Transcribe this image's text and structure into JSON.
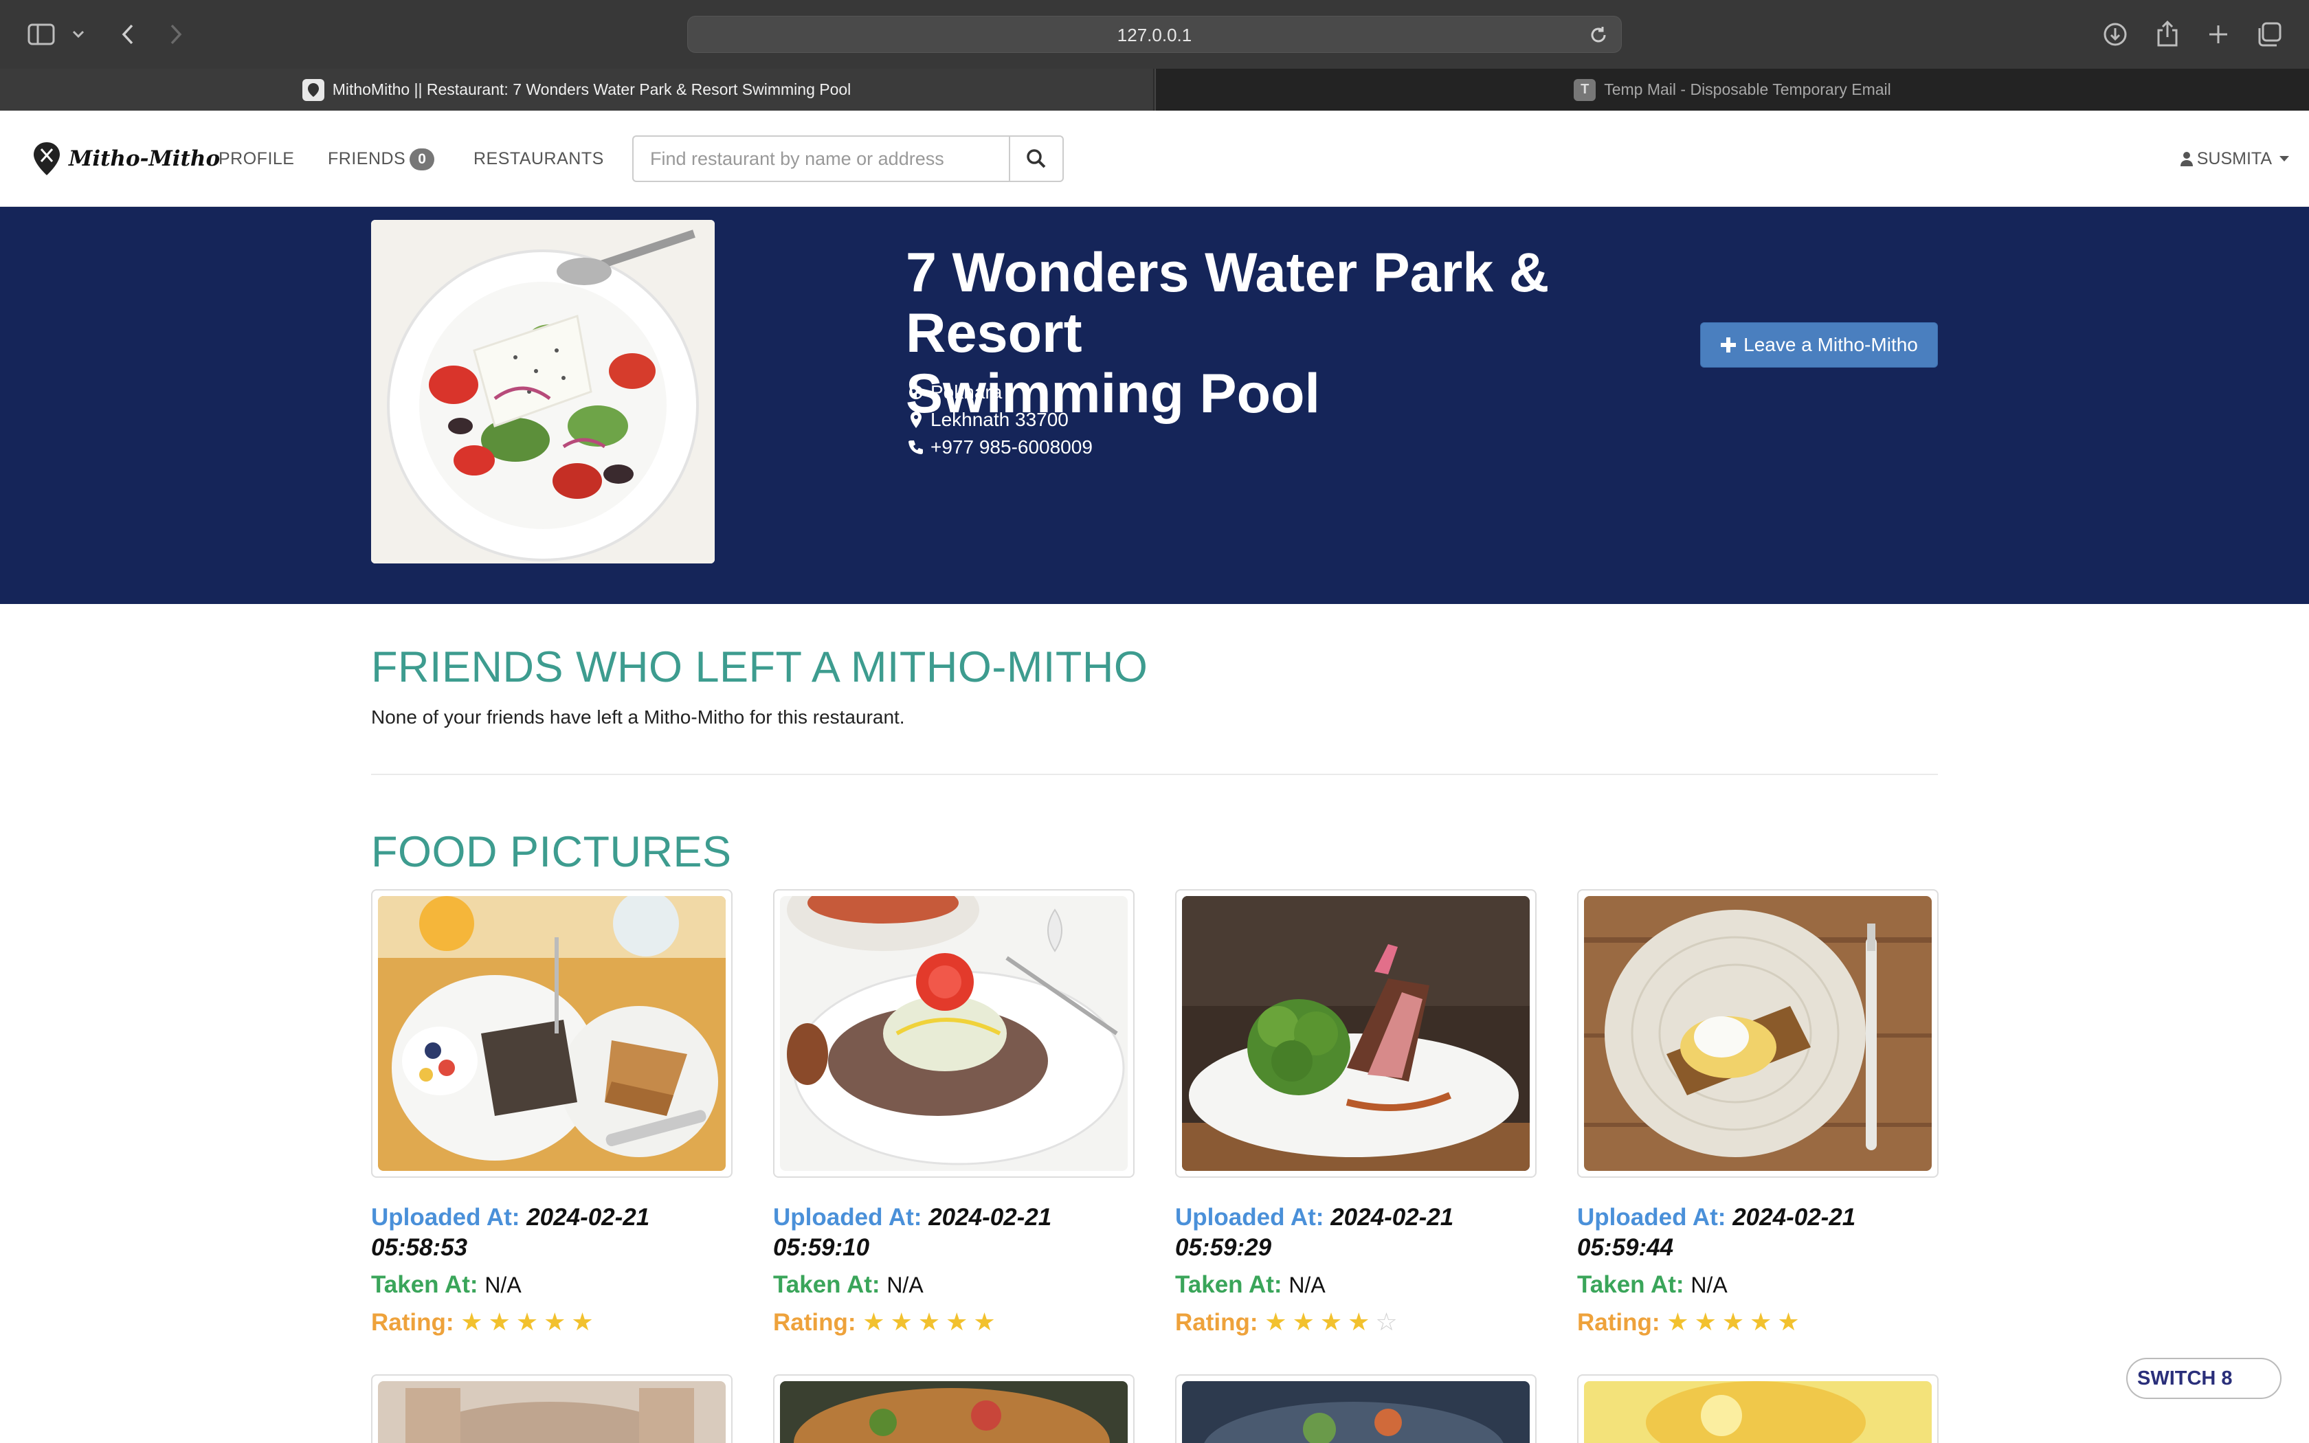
{
  "browser": {
    "url": "127.0.0.1",
    "tabs": [
      {
        "title": "MithoMitho || Restaurant: 7 Wonders Water Park & Resort Swimming Pool",
        "favicon": "",
        "active": true
      },
      {
        "title": "Temp Mail - Disposable Temporary Email",
        "favicon": "T",
        "active": false
      }
    ]
  },
  "nav": {
    "brand": "Mitho-Mitho",
    "profile": "PROFILE",
    "friends": "FRIENDS",
    "friends_count": "0",
    "restaurants": "RESTAURANTS",
    "search_placeholder": "Find restaurant by name or address",
    "user": "SUSMITA"
  },
  "restaurant": {
    "title_line1": "7 Wonders Water Park & Resort",
    "title_line2": "Swimming Pool",
    "city": "Pokhara",
    "address": "Lekhnath 33700",
    "phone": "+977 985-6008009",
    "leave_button": "Leave a Mitho-Mitho"
  },
  "friends_section": {
    "title": "FRIENDS WHO LEFT A MITHO-MITHO",
    "empty_text": "None of your friends have left a Mitho-Mitho for this restaurant."
  },
  "pictures_section": {
    "title": "FOOD PICTURES",
    "labels": {
      "uploaded": "Uploaded At:",
      "taken": "Taken At:",
      "rating": "Rating:"
    },
    "items": [
      {
        "uploaded_date": "2024-02-21",
        "uploaded_time": "05:58:53",
        "taken": "N/A",
        "rating": 5
      },
      {
        "uploaded_date": "2024-02-21",
        "uploaded_time": "05:59:10",
        "taken": "N/A",
        "rating": 5
      },
      {
        "uploaded_date": "2024-02-21",
        "uploaded_time": "05:59:29",
        "taken": "N/A",
        "rating": 4
      },
      {
        "uploaded_date": "2024-02-21",
        "uploaded_time": "05:59:44",
        "taken": "N/A",
        "rating": 5
      }
    ]
  },
  "switch_button": "SWITCH 8",
  "colors": {
    "banner": "#152559",
    "section_title": "#3d9c8f",
    "uploaded_label": "#4a90d9",
    "taken_label": "#3aa55a",
    "rating_label": "#eea23b",
    "star": "#f2c12e"
  }
}
